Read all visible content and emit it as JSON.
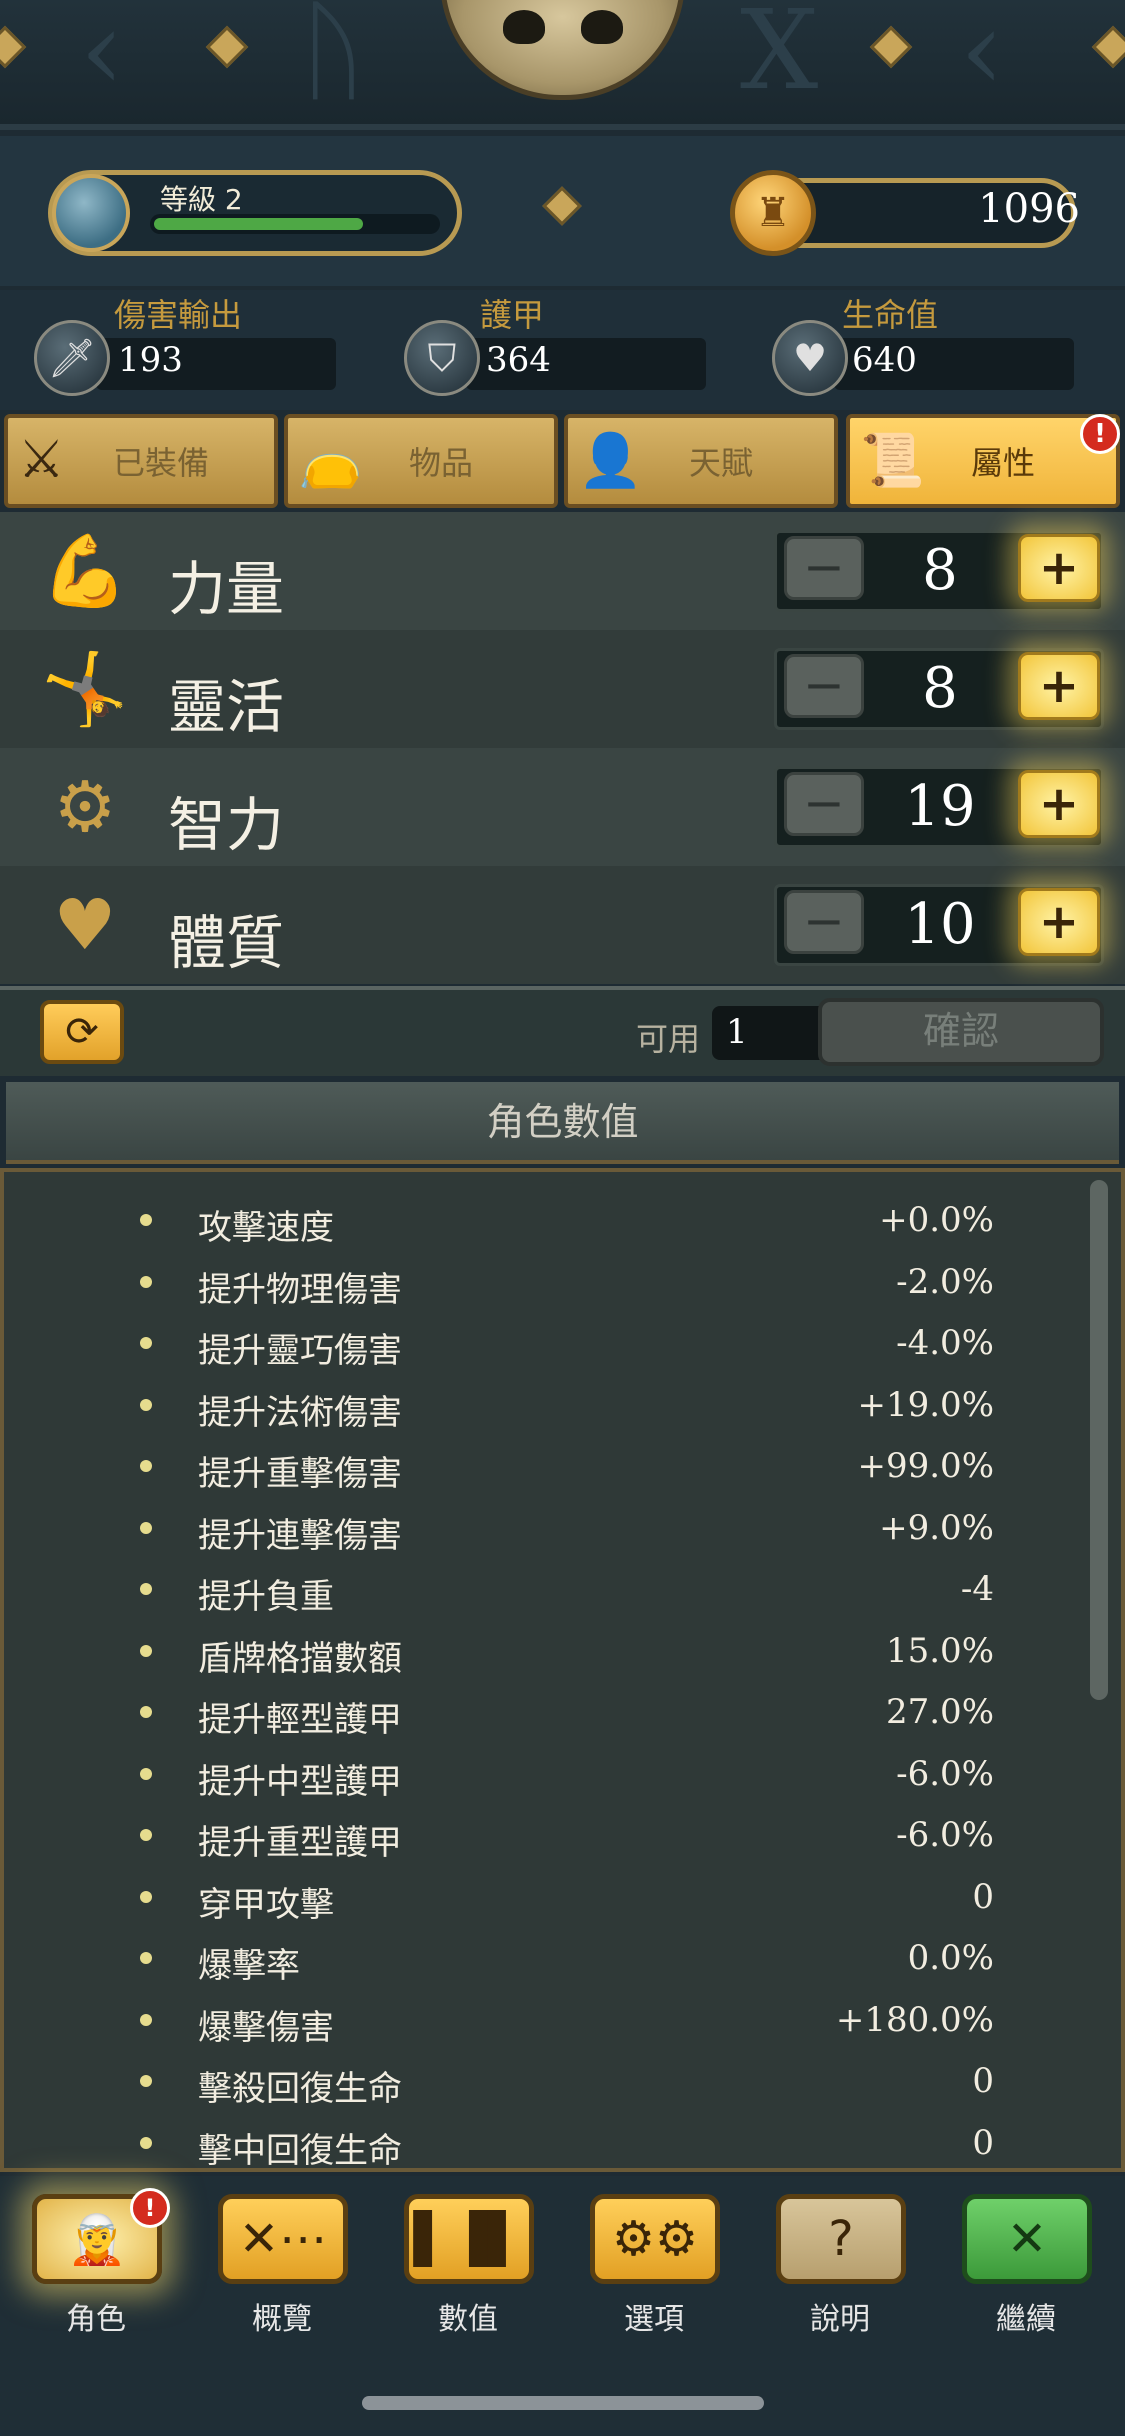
{
  "header": {
    "level_label": "等級 2",
    "xp_progress_fraction": 0.74,
    "gold": "1096"
  },
  "stats": [
    {
      "label": "傷害輸出",
      "value": "193",
      "icon": "sword-icon"
    },
    {
      "label": "護甲",
      "value": "364",
      "icon": "shield-icon"
    },
    {
      "label": "生命值",
      "value": "640",
      "icon": "heart-icon"
    }
  ],
  "tabs": [
    {
      "label": "已裝備",
      "icon": "sword-shield-icon",
      "active": false
    },
    {
      "label": "物品",
      "icon": "bag-icon",
      "active": false
    },
    {
      "label": "天賦",
      "icon": "talent-icon",
      "active": false
    },
    {
      "label": "屬性",
      "icon": "scroll-icon",
      "active": true
    }
  ],
  "tab_badge": "!",
  "attributes": [
    {
      "name": "力量",
      "value": "8",
      "icon": "strength-icon"
    },
    {
      "name": "靈活",
      "value": "8",
      "icon": "agility-icon"
    },
    {
      "name": "智力",
      "value": "19",
      "icon": "intellect-icon"
    },
    {
      "name": "體質",
      "value": "10",
      "icon": "constitution-icon"
    }
  ],
  "controls": {
    "minus_symbol": "−",
    "plus_symbol": "+",
    "reset_symbol": "⟳",
    "available_label": "可用",
    "available_value": "1",
    "confirm_label": "確認"
  },
  "character_stats_title": "角色數值",
  "character_stats": [
    {
      "label": "攻擊速度",
      "value": "+0.0%"
    },
    {
      "label": "提升物理傷害",
      "value": "-2.0%"
    },
    {
      "label": "提升靈巧傷害",
      "value": "-4.0%"
    },
    {
      "label": "提升法術傷害",
      "value": "+19.0%"
    },
    {
      "label": "提升重擊傷害",
      "value": "+99.0%"
    },
    {
      "label": "提升連擊傷害",
      "value": "+9.0%"
    },
    {
      "label": "提升負重",
      "value": "-4"
    },
    {
      "label": "盾牌格擋數額",
      "value": "15.0%"
    },
    {
      "label": "提升輕型護甲",
      "value": "27.0%"
    },
    {
      "label": "提升中型護甲",
      "value": "-6.0%"
    },
    {
      "label": "提升重型護甲",
      "value": "-6.0%"
    },
    {
      "label": "穿甲攻擊",
      "value": "0"
    },
    {
      "label": "爆擊率",
      "value": "0.0%"
    },
    {
      "label": "爆擊傷害",
      "value": "+180.0%"
    },
    {
      "label": "擊殺回復生命",
      "value": "0"
    },
    {
      "label": "擊中回復生命",
      "value": "0"
    }
  ],
  "bottom_nav": [
    {
      "label": "角色",
      "icon": "character-portrait-icon"
    },
    {
      "label": "概覽",
      "icon": "map-icon"
    },
    {
      "label": "數值",
      "icon": "bar-chart-icon"
    },
    {
      "label": "選項",
      "icon": "gears-icon"
    },
    {
      "label": "說明",
      "icon": "question-icon"
    },
    {
      "label": "繼續",
      "icon": "close-x-icon"
    }
  ],
  "nav_badge": "!",
  "colors": {
    "accent_gold": "#f0b43a",
    "xp_green": "#4ea845",
    "badge_red": "#d42b1e",
    "continue_green": "#4cb04a"
  }
}
